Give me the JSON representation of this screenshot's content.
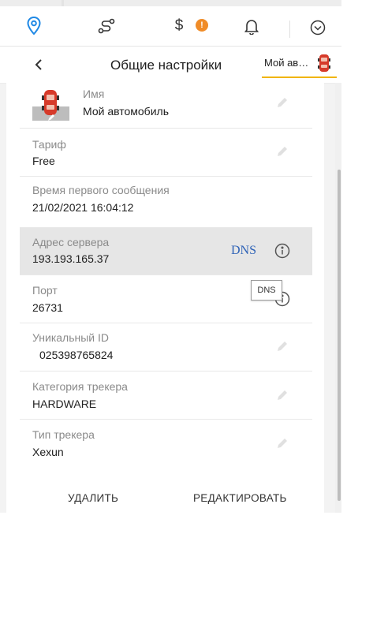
{
  "nav": {
    "items": [
      {
        "icon": "map-pin-icon"
      },
      {
        "icon": "route-icon"
      },
      {
        "icon": "dollar-icon"
      },
      {
        "icon": "bell-icon"
      },
      {
        "icon": "chevron-circle-down-icon"
      }
    ],
    "badge": "!"
  },
  "header": {
    "title": "Общие настройки",
    "object_name": "Мой ав…"
  },
  "fields": [
    {
      "label": "Имя",
      "value": "Мой автомобиль"
    },
    {
      "label": "Тариф",
      "value": "Free"
    },
    {
      "label": "Время первого сообщения",
      "value": "21/02/2021 16:04:12"
    },
    {
      "label": "Адрес сервера",
      "value": "193.193.165.37",
      "link": "DNS"
    },
    {
      "label": "Порт",
      "value": "26731"
    },
    {
      "label": "Уникальный ID",
      "value": "025398765824"
    },
    {
      "label": "Категория трекера",
      "value": "HARDWARE"
    },
    {
      "label": "Тип трекера",
      "value": "Xexun"
    }
  ],
  "tooltip": "DNS",
  "actions": {
    "delete": "УДАЛИТЬ",
    "edit": "РЕДАКТИРОВАТЬ"
  },
  "colors": {
    "accent_blue": "#1e88e5",
    "badge_orange": "#f08c28",
    "link_blue": "#2f63b7",
    "underline_yellow": "#f0b400",
    "car_red": "#d63a2a"
  }
}
